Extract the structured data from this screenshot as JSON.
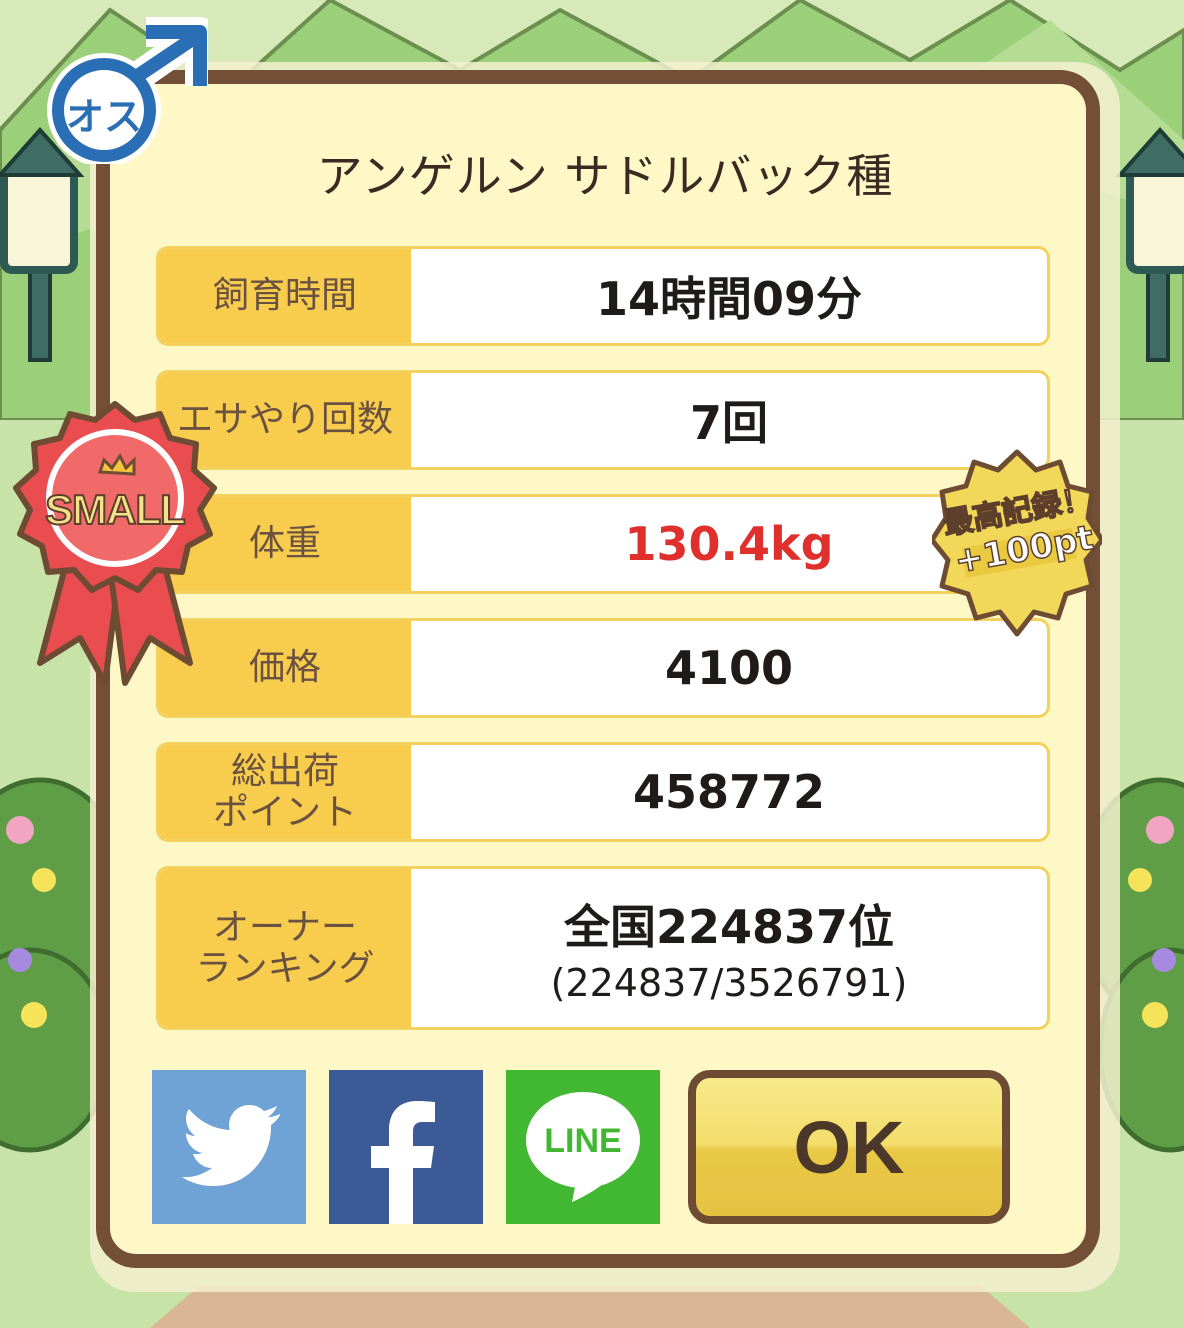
{
  "header": {
    "gender_badge": "オス",
    "title": "アンゲルン サドルバック種"
  },
  "ribbon": {
    "text": "SMALL"
  },
  "record_badge": {
    "line1": "最高記録！",
    "line2": "+100pt"
  },
  "rows": [
    {
      "label": "飼育時間",
      "value": "14時間09分"
    },
    {
      "label": "エサやり回数",
      "value": "7回"
    },
    {
      "label": "体重",
      "value": "130.4kg"
    },
    {
      "label": "価格",
      "value": "4100"
    },
    {
      "label_line1": "総出荷",
      "label_line2": "ポイント",
      "value": "458772"
    },
    {
      "label_line1": "オーナー",
      "label_line2": "ランキング",
      "value": "全国224837位",
      "sub": "(224837/3526791)"
    }
  ],
  "buttons": {
    "line_label": "LINE",
    "ok_label": "OK"
  },
  "colors": {
    "panel_border": "#734f37",
    "label_bg": "#f8cd4e",
    "weight_value": "#e0302d",
    "twitter": "#6fa3d6",
    "facebook": "#3b5a96",
    "line": "#42b832",
    "gender_blue": "#2a6fb5"
  },
  "icons": [
    "male-symbol-icon",
    "twitter-bird-icon",
    "facebook-f-icon",
    "line-speech-bubble-icon",
    "crown-icon"
  ]
}
